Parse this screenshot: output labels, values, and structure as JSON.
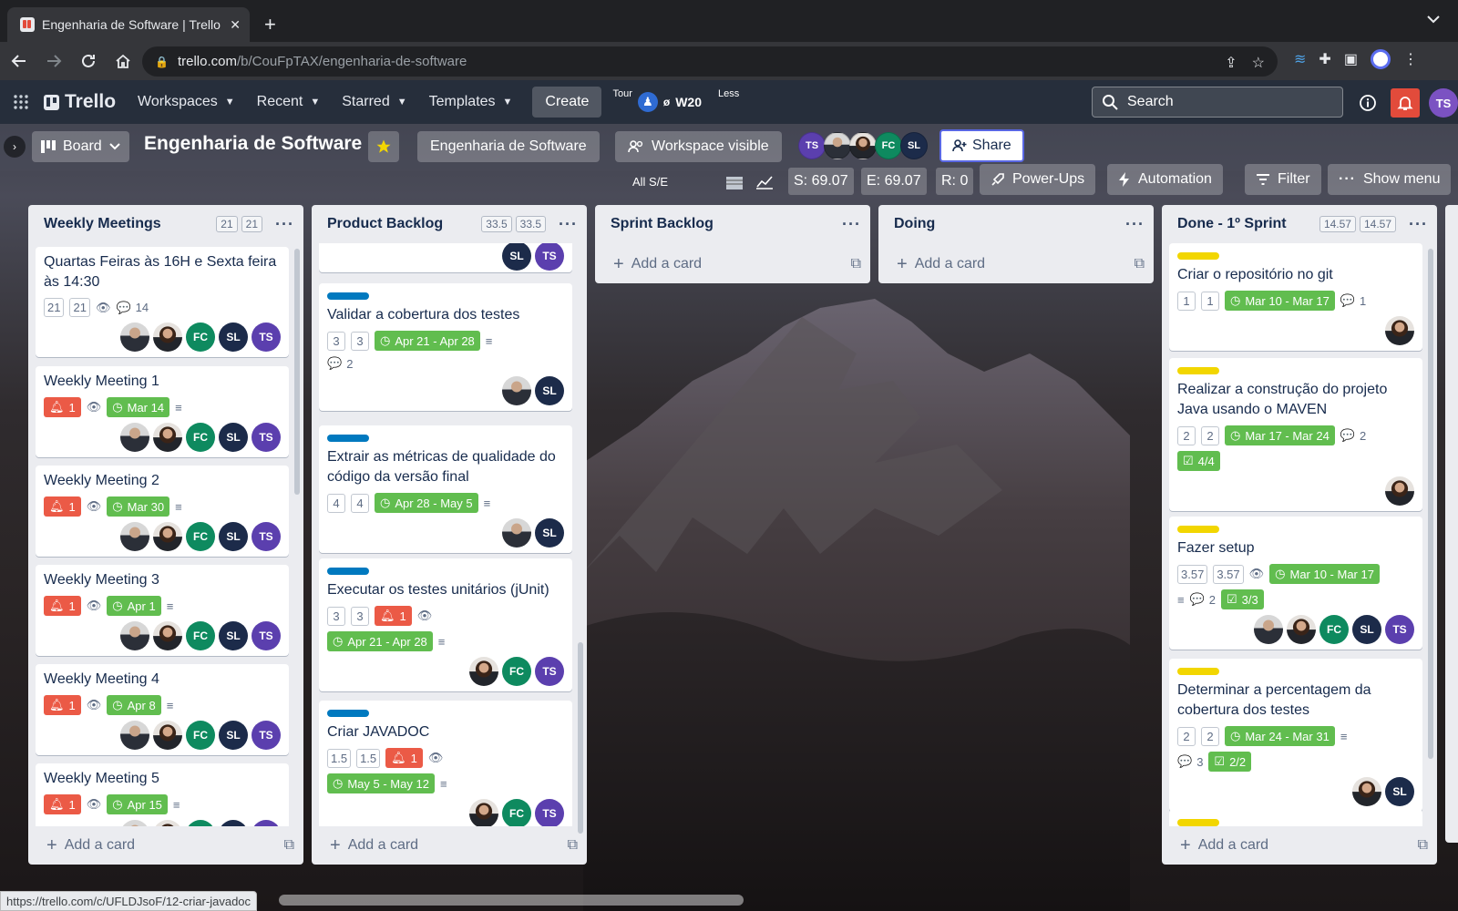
{
  "browser": {
    "tab_title": "Engenharia de Software | Trello",
    "url_domain": "trello.com",
    "url_path": "/b/CouFpTAX/engenharia-de-software",
    "status_url": "https://trello.com/c/UFLDJsoF/12-criar-javadoc"
  },
  "nav": {
    "logo": "Trello",
    "workspaces": "Workspaces",
    "recent": "Recent",
    "starred": "Starred",
    "templates": "Templates",
    "create": "Create",
    "tour": "Tour",
    "tour_badge": "ø",
    "w20": "W20",
    "less": "Less",
    "search_placeholder": "Search",
    "user_initials": "TS"
  },
  "board": {
    "view": "Board",
    "title": "Engenharia de Software",
    "workspace": "Engenharia de Software",
    "visibility": "Workspace visible",
    "members": [
      "TS",
      "photo",
      "photo",
      "FC",
      "SL"
    ],
    "share": "Share",
    "all_se": "All S/E",
    "s_metric": "S: 69.07",
    "e_metric": "E: 69.07",
    "r_metric": "R: 0",
    "powerups": "Power-Ups",
    "automation": "Automation",
    "filter": "Filter",
    "show_menu": "Show menu"
  },
  "lists": {
    "weekly": {
      "title": "Weekly Meetings",
      "badge_a": "21",
      "badge_b": "21",
      "add": "Add a card",
      "cards": [
        {
          "title": "Quartas Feiras às 16H e Sexta feira às 14:30",
          "est_a": "21",
          "est_b": "21",
          "comments": "14"
        },
        {
          "title": "Weekly Meeting 1",
          "alert": "1",
          "due": "Mar 14"
        },
        {
          "title": "Weekly Meeting 2",
          "alert": "1",
          "due": "Mar 30"
        },
        {
          "title": "Weekly Meeting 3",
          "alert": "1",
          "due": "Apr 1"
        },
        {
          "title": "Weekly Meeting 4",
          "alert": "1",
          "due": "Apr 8"
        },
        {
          "title": "Weekly Meeting 5",
          "alert": "1",
          "due": "Apr 15"
        }
      ]
    },
    "backlog": {
      "title": "Product Backlog",
      "badge_a": "33.5",
      "badge_b": "33.5",
      "add": "Add a card",
      "cards": [
        {
          "title": "Validar a cobertura dos testes",
          "est_a": "3",
          "est_b": "3",
          "due": "Apr 21 - Apr 28",
          "comments": "2"
        },
        {
          "title": "Extrair as métricas de qualidade do código da versão final",
          "est_a": "4",
          "est_b": "4",
          "due": "Apr 28 - May 5"
        },
        {
          "title": "Executar os testes unitários (jUnit)",
          "est_a": "3",
          "est_b": "3",
          "alert": "1",
          "due": "Apr 21 - Apr 28"
        },
        {
          "title": "Criar JAVADOC",
          "est_a": "1.5",
          "est_b": "1.5",
          "alert": "1",
          "due": "May 5 - May 12"
        }
      ]
    },
    "sprint": {
      "title": "Sprint Backlog",
      "add": "Add a card"
    },
    "doing": {
      "title": "Doing",
      "add": "Add a card"
    },
    "done": {
      "title": "Done - 1º Sprint",
      "badge_a": "14.57",
      "badge_b": "14.57",
      "add": "Add a card",
      "cards": [
        {
          "title": "Criar o repositório no git",
          "est_a": "1",
          "est_b": "1",
          "due": "Mar 10 - Mar 17",
          "comments": "1"
        },
        {
          "title": "Realizar a construção do projeto Java usando o MAVEN",
          "est_a": "2",
          "est_b": "2",
          "due": "Mar 17 - Mar 24",
          "comments": "2",
          "check": "4/4"
        },
        {
          "title": "Fazer setup",
          "est_a": "3.57",
          "est_b": "3.57",
          "due": "Mar 10 - Mar 17",
          "comments": "2",
          "check": "3/3"
        },
        {
          "title": "Determinar a percentagem da cobertura dos testes",
          "est_a": "2",
          "est_b": "2",
          "due": "Mar 24 - Mar 31",
          "comments": "3",
          "check": "2/2"
        }
      ]
    }
  },
  "colors": {
    "label_blue": "#0079bf",
    "label_yellow": "#f2d600",
    "green": "#61bd4f",
    "red": "#eb5a46"
  }
}
